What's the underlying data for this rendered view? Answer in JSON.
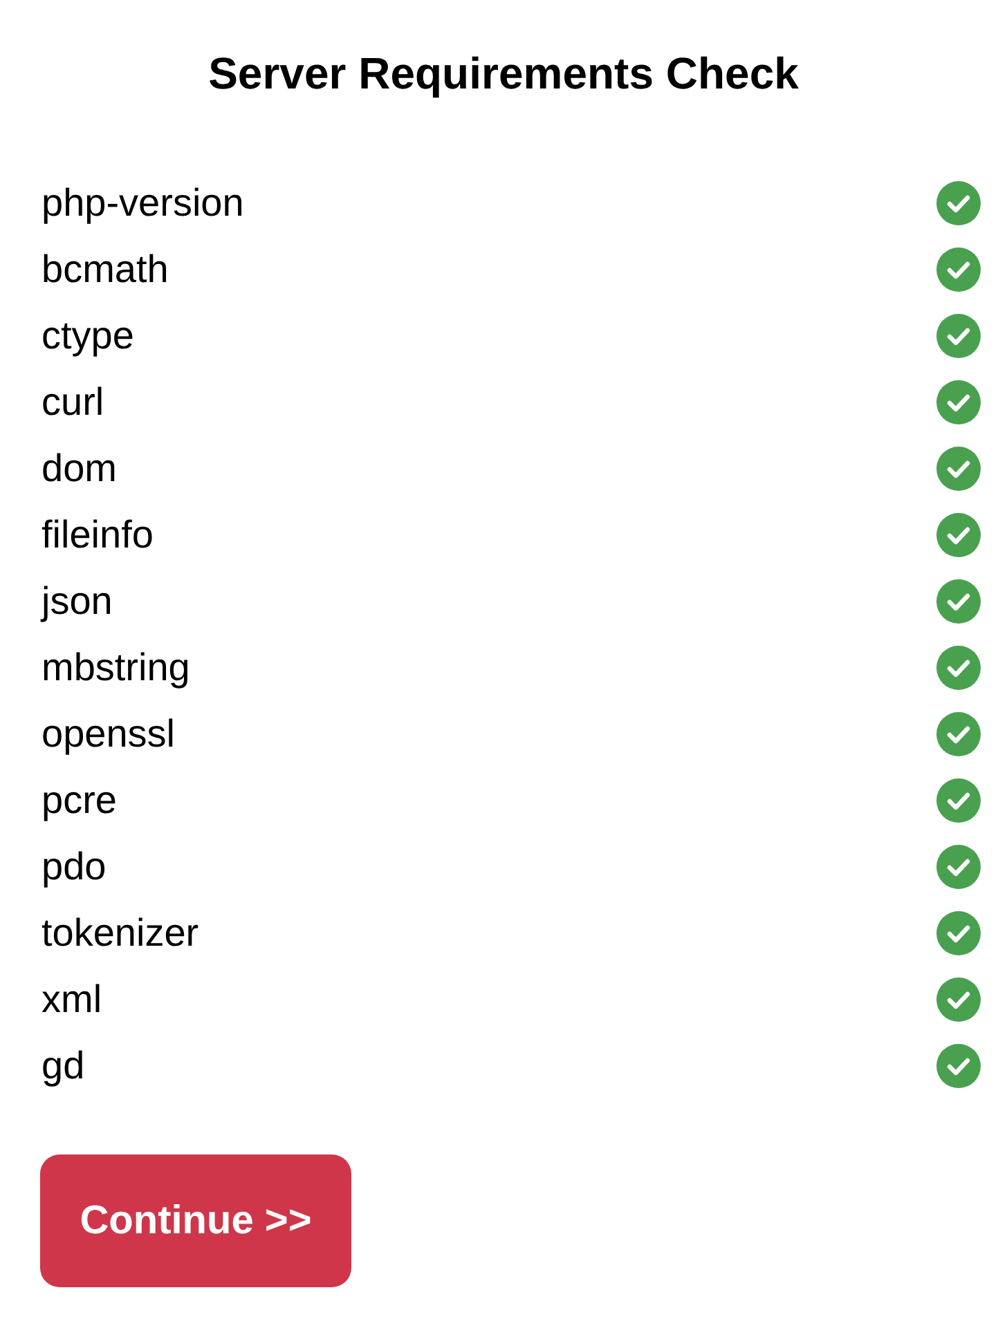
{
  "title": "Server Requirements Check",
  "requirements": [
    {
      "name": "php-version",
      "passed": true
    },
    {
      "name": "bcmath",
      "passed": true
    },
    {
      "name": "ctype",
      "passed": true
    },
    {
      "name": "curl",
      "passed": true
    },
    {
      "name": "dom",
      "passed": true
    },
    {
      "name": "fileinfo",
      "passed": true
    },
    {
      "name": "json",
      "passed": true
    },
    {
      "name": "mbstring",
      "passed": true
    },
    {
      "name": "openssl",
      "passed": true
    },
    {
      "name": "pcre",
      "passed": true
    },
    {
      "name": "pdo",
      "passed": true
    },
    {
      "name": "tokenizer",
      "passed": true
    },
    {
      "name": "xml",
      "passed": true
    },
    {
      "name": "gd",
      "passed": true
    }
  ],
  "button": {
    "label": "Continue >>"
  }
}
